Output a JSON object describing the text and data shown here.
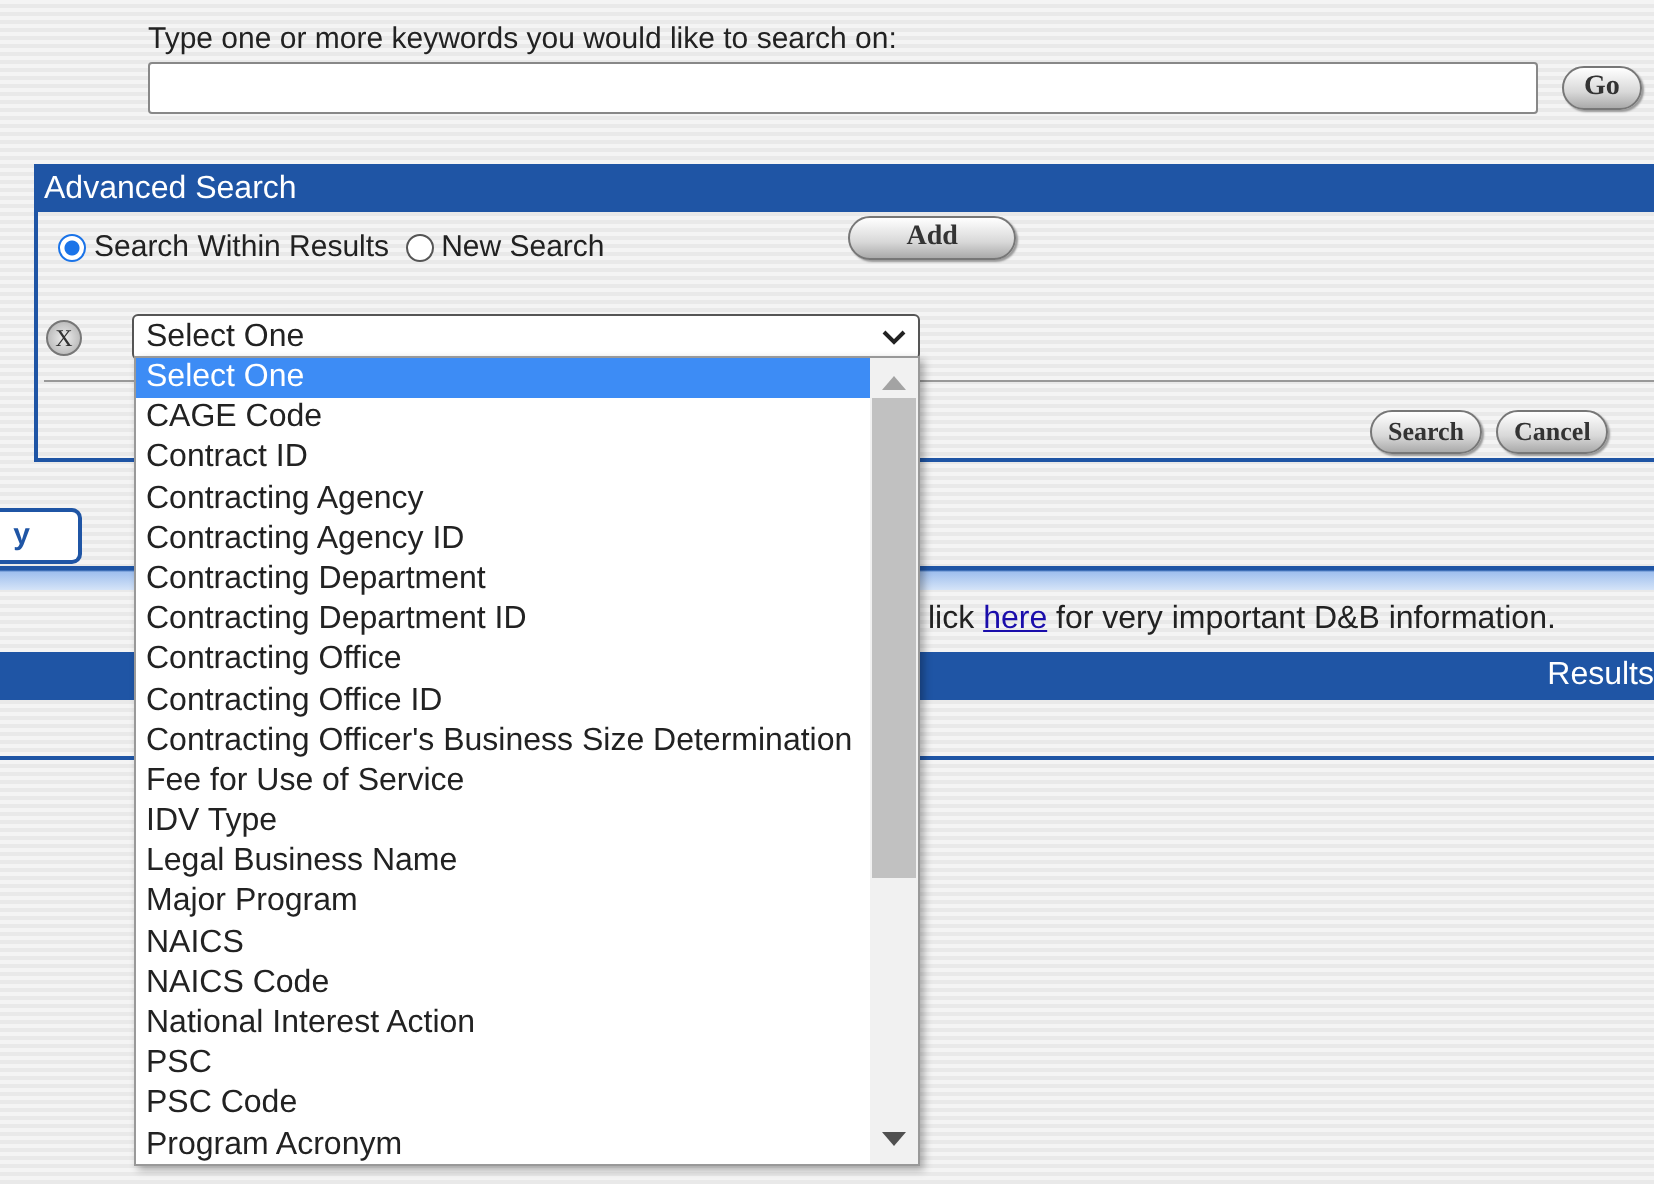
{
  "keyword_search": {
    "label": "Type one or more keywords you would like to search on:",
    "button": "Go"
  },
  "advanced_search": {
    "title": "Advanced Search",
    "scope_options": [
      {
        "label": "Search Within Results",
        "selected": true
      },
      {
        "label": "New Search",
        "selected": false
      }
    ],
    "add_button": "Add",
    "remove_button": "X",
    "field_select": {
      "value": "Select One",
      "expanded": true,
      "options": [
        {
          "label": "Select One",
          "selected": true
        },
        {
          "label": "CAGE Code",
          "selected": false
        },
        {
          "label": "Contract ID",
          "selected": false
        },
        {
          "label": "Contracting Agency",
          "selected": false
        },
        {
          "label": "Contracting Agency ID",
          "selected": false
        },
        {
          "label": "Contracting Department",
          "selected": false
        },
        {
          "label": "Contracting Department ID",
          "selected": false
        },
        {
          "label": "Contracting Office",
          "selected": false
        },
        {
          "label": "Contracting Office ID",
          "selected": false
        },
        {
          "label": "Contracting Officer's Business Size Determination",
          "selected": false
        },
        {
          "label": "Fee for Use of Service",
          "selected": false
        },
        {
          "label": "IDV Type",
          "selected": false
        },
        {
          "label": "Legal Business Name",
          "selected": false
        },
        {
          "label": "Major Program",
          "selected": false
        },
        {
          "label": "NAICS",
          "selected": false
        },
        {
          "label": "NAICS Code",
          "selected": false
        },
        {
          "label": "National Interest Action",
          "selected": false
        },
        {
          "label": "PSC",
          "selected": false
        },
        {
          "label": "PSC Code",
          "selected": false
        },
        {
          "label": "Program Acronym",
          "selected": false
        }
      ]
    },
    "buttons": [
      "Search",
      "Cancel"
    ]
  },
  "tab": {
    "label": "y"
  },
  "notice": {
    "before": "lick ",
    "link": "here",
    "after": " for very important D&B information."
  },
  "results_bar": {
    "title": "Results"
  }
}
